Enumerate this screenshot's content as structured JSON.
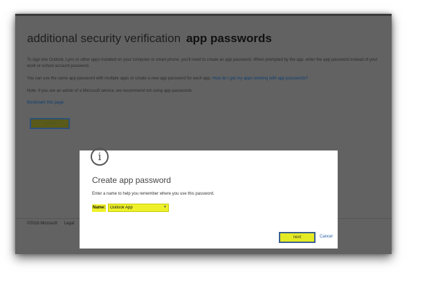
{
  "page": {
    "title_main": "additional security verification",
    "title_sub": "app passwords",
    "para1": "To sign into Outlook, Lync or other apps installed on your computer or smart phone, you'll need to create an app password. When prompted by the app, enter the app password instead of your work or school account password.",
    "para2_text": "You can use the same app password with multiple apps or create a new app password for each app.",
    "para2_link": "How do I get my apps working with app passwords?",
    "para3": "Note: If you are an admin of a Microsoft service, we recommend not using app passwords.",
    "bookmark": "Bookmark this page",
    "create_label": "create"
  },
  "footer": {
    "copyright": "©2016 Microsoft",
    "legal": "Legal"
  },
  "dialog": {
    "icon": "info-icon",
    "title": "Create app password",
    "description": "Enter a name to help you remember where you use this password.",
    "name_label": "Name:",
    "name_value": "Outlook App",
    "next_label": "next",
    "cancel_label": "Cancel"
  },
  "colors": {
    "overlay": "#626262",
    "highlight": "#eef12a",
    "link": "#1f5aa0"
  }
}
